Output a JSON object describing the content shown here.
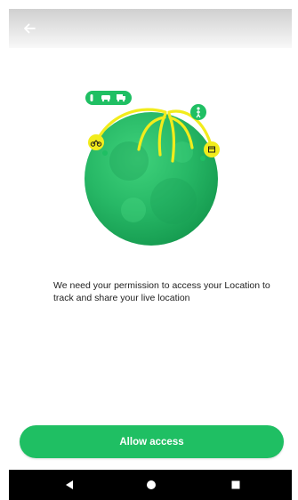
{
  "header": {
    "back_icon": "arrow-left-icon"
  },
  "illustration": {
    "globe_color": "#27b866",
    "rope_color": "#f2ec1c",
    "vehicle_icons": [
      "bicycle-icon",
      "car-icon",
      "truck-icon"
    ],
    "scooter_icon": "scooter-icon",
    "walker_icon": "walker-icon",
    "parcel_icon": "parcel-icon"
  },
  "permission": {
    "message": "We need your permission to access your Location to track and share your live location"
  },
  "actions": {
    "allow_label": "Allow access",
    "allow_color": "#1fbf63"
  },
  "navigation": {
    "back_icon": "nav-back-icon",
    "home_icon": "nav-home-icon",
    "recents_icon": "nav-recents-icon"
  }
}
